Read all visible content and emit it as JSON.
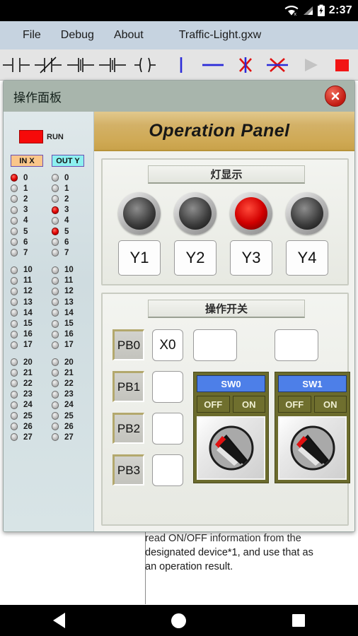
{
  "statusbar": {
    "time": "2:37",
    "wifi_icon": "wifi-off-icon",
    "signal_icon": "signal-icon",
    "battery_icon": "battery-charging-icon"
  },
  "menubar": {
    "items": [
      {
        "label": "File"
      },
      {
        "label": "Debug"
      },
      {
        "label": "About"
      }
    ],
    "file_name": "Traffic-Light.gxw"
  },
  "toolbar": {
    "buttons": [
      {
        "name": "contact-no-icon",
        "title": "normally-open-contact"
      },
      {
        "name": "contact-nc-icon",
        "title": "normally-closed-contact"
      },
      {
        "name": "contact-rising-icon",
        "title": "rising-edge-contact"
      },
      {
        "name": "contact-falling-icon",
        "title": "falling-edge-contact"
      },
      {
        "name": "coil-icon",
        "title": "output-coil"
      },
      {
        "name": "vertical-line-icon",
        "title": "vertical-link"
      },
      {
        "name": "horizontal-line-icon",
        "title": "horizontal-link"
      },
      {
        "name": "delete-vertical-icon",
        "title": "delete-vertical-link"
      },
      {
        "name": "delete-horizontal-icon",
        "title": "delete-horizontal-link"
      },
      {
        "name": "run-icon",
        "title": "run"
      },
      {
        "name": "stop-icon",
        "title": "stop"
      }
    ]
  },
  "dialog": {
    "title": "操作面板",
    "close_label": "close",
    "banner": "Operation Panel",
    "io_panel": {
      "run_label": "RUN",
      "run_color": "#f60a0a",
      "in_header": "IN X",
      "out_header": "OUT Y",
      "in_header_color": "#fbc68a",
      "out_header_color": "#8df0f0",
      "groups": [
        {
          "in": [
            {
              "n": "0",
              "on": true
            },
            {
              "n": "1",
              "on": false
            },
            {
              "n": "2",
              "on": false
            },
            {
              "n": "3",
              "on": false
            },
            {
              "n": "4",
              "on": false
            },
            {
              "n": "5",
              "on": false
            },
            {
              "n": "6",
              "on": false
            },
            {
              "n": "7",
              "on": false
            }
          ],
          "out": [
            {
              "n": "0",
              "on": false
            },
            {
              "n": "1",
              "on": false
            },
            {
              "n": "2",
              "on": false
            },
            {
              "n": "3",
              "on": true
            },
            {
              "n": "4",
              "on": false
            },
            {
              "n": "5",
              "on": true
            },
            {
              "n": "6",
              "on": false
            },
            {
              "n": "7",
              "on": false
            }
          ]
        },
        {
          "in": [
            {
              "n": "10",
              "on": false
            },
            {
              "n": "11",
              "on": false
            },
            {
              "n": "12",
              "on": false
            },
            {
              "n": "13",
              "on": false
            },
            {
              "n": "14",
              "on": false
            },
            {
              "n": "15",
              "on": false
            },
            {
              "n": "16",
              "on": false
            },
            {
              "n": "17",
              "on": false
            }
          ],
          "out": [
            {
              "n": "10",
              "on": false
            },
            {
              "n": "11",
              "on": false
            },
            {
              "n": "12",
              "on": false
            },
            {
              "n": "13",
              "on": false
            },
            {
              "n": "14",
              "on": false
            },
            {
              "n": "15",
              "on": false
            },
            {
              "n": "16",
              "on": false
            },
            {
              "n": "17",
              "on": false
            }
          ]
        },
        {
          "in": [
            {
              "n": "20",
              "on": false
            },
            {
              "n": "21",
              "on": false
            },
            {
              "n": "22",
              "on": false
            },
            {
              "n": "23",
              "on": false
            },
            {
              "n": "24",
              "on": false
            },
            {
              "n": "25",
              "on": false
            },
            {
              "n": "26",
              "on": false
            },
            {
              "n": "27",
              "on": false
            }
          ],
          "out": [
            {
              "n": "20",
              "on": false
            },
            {
              "n": "21",
              "on": false
            },
            {
              "n": "22",
              "on": false
            },
            {
              "n": "23",
              "on": false
            },
            {
              "n": "24",
              "on": false
            },
            {
              "n": "25",
              "on": false
            },
            {
              "n": "26",
              "on": false
            },
            {
              "n": "27",
              "on": false
            }
          ]
        }
      ]
    },
    "lamp_group": {
      "title": "灯显示",
      "lamps": [
        {
          "label": "Y1",
          "on": false
        },
        {
          "label": "Y2",
          "on": false
        },
        {
          "label": "Y3",
          "on": true
        },
        {
          "label": "Y4",
          "on": false
        }
      ],
      "on_color": "#d20000"
    },
    "switch_group": {
      "title": "操作开关",
      "push_buttons": [
        {
          "label": "PB0",
          "device": "X0"
        },
        {
          "label": "PB1",
          "device": ""
        },
        {
          "label": "PB2",
          "device": ""
        },
        {
          "label": "PB3",
          "device": ""
        }
      ],
      "top_fields": [
        {
          "value": ""
        },
        {
          "value": ""
        }
      ],
      "switches": [
        {
          "label": "SW0",
          "off_label": "OFF",
          "on_label": "ON",
          "state": "off"
        },
        {
          "label": "SW1",
          "off_label": "OFF",
          "on_label": "ON",
          "state": "off"
        }
      ],
      "header_color": "#4d7fe8",
      "panel_color": "#6b6b2c"
    }
  },
  "background_document": {
    "line1": "read ON/OFF information from the",
    "line2": "designated device*1, and use that as",
    "line3": "an operation result."
  },
  "navbar": {
    "back": "back",
    "home": "home",
    "recents": "recents"
  }
}
